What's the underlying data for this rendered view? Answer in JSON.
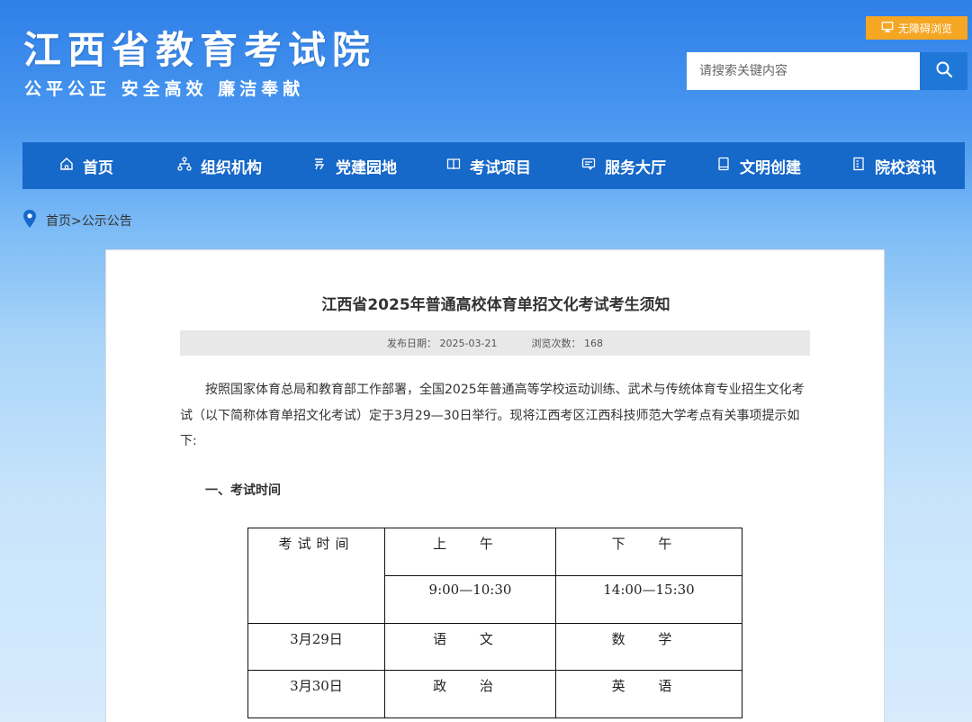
{
  "header": {
    "site_title": "江西省教育考试院",
    "motto": "公平公正 安全高效 廉洁奉献",
    "accessibility_label": "无障碍浏览",
    "search_placeholder": "请搜索关键内容"
  },
  "nav": {
    "items": [
      {
        "label": "首页",
        "icon": "home-icon"
      },
      {
        "label": "组织机构",
        "icon": "org-chart-icon"
      },
      {
        "label": "党建园地",
        "icon": "party-icon"
      },
      {
        "label": "考试项目",
        "icon": "book-open-icon"
      },
      {
        "label": "服务大厅",
        "icon": "service-icon"
      },
      {
        "label": "文明创建",
        "icon": "tablet-icon"
      },
      {
        "label": "院校资讯",
        "icon": "document-icon"
      }
    ]
  },
  "breadcrumb": {
    "home": "首页",
    "separator": ">",
    "current": "公示公告"
  },
  "article": {
    "title": "江西省2025年普通高校体育单招文化考试考生须知",
    "publish_date": "发布日期：  2025-03-21",
    "views": "浏览次数：  168",
    "intro": "按照国家体育总局和教育部工作部署，全国2025年普通高等学校运动训练、武术与传统体育专业招生文化考试（以下简称体育单招文化考试）定于3月29—30日举行。现将江西考区江西科技师范大学考点有关事项提示如下:",
    "section1_heading": "一、考试时间",
    "table": {
      "header_label": "考试时间",
      "morning": "上 午",
      "afternoon": "下 午",
      "morning_time": "9:00—10:30",
      "afternoon_time": "14:00—15:30",
      "rows": [
        {
          "date": "3月29日",
          "morning": "语 文",
          "afternoon": "数 学"
        },
        {
          "date": "3月30日",
          "morning": "政 治",
          "afternoon": "英 语"
        }
      ]
    }
  },
  "colors": {
    "nav_bg": "#1668c9",
    "accent_orange": "#f5a623",
    "search_btn": "#1f78d8"
  }
}
